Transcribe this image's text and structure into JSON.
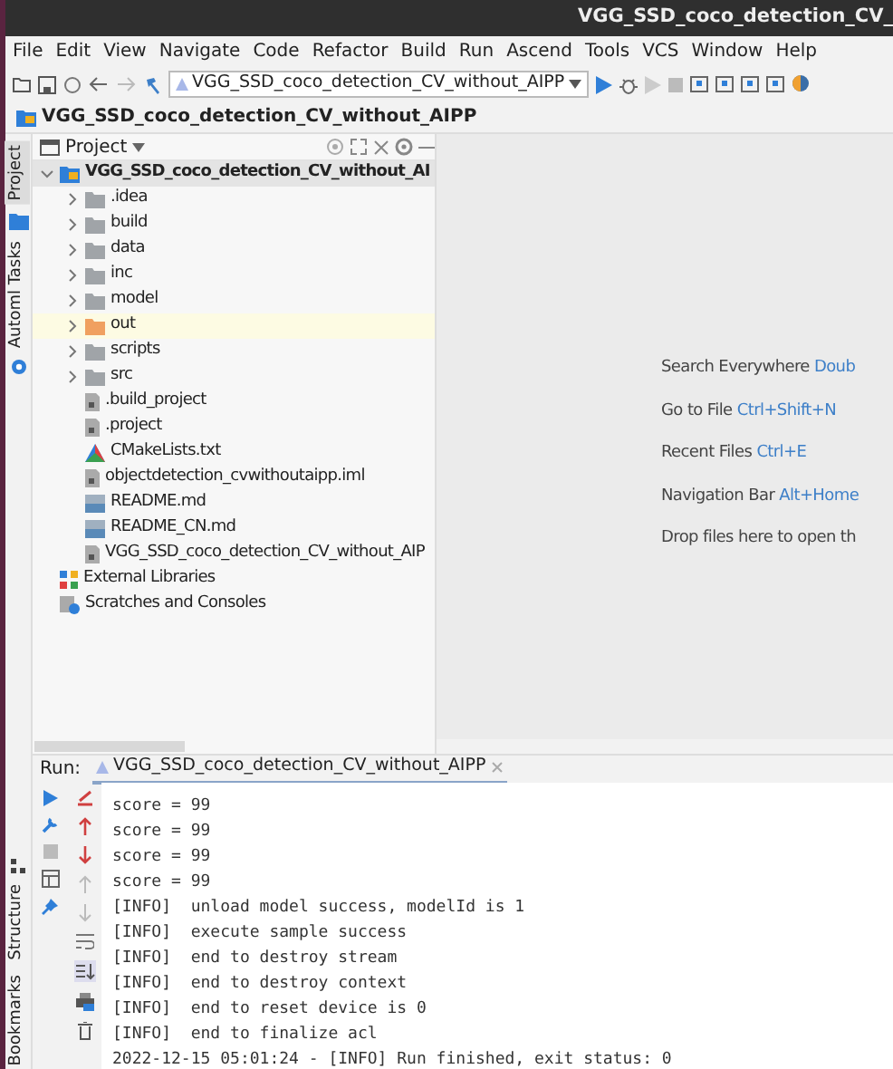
{
  "window": {
    "title": "VGG_SSD_coco_detection_CV_"
  },
  "menu": [
    "File",
    "Edit",
    "View",
    "Navigate",
    "Code",
    "Refactor",
    "Build",
    "Run",
    "Ascend",
    "Tools",
    "VCS",
    "Window",
    "Help"
  ],
  "toolbar": {
    "run_config": "VGG_SSD_coco_detection_CV_without_AIPP"
  },
  "breadcrumb": "VGG_SSD_coco_detection_CV_without_AIPP",
  "side_tabs": [
    {
      "label": "Project",
      "selected": true
    },
    {
      "label": "Automl Tasks",
      "selected": false
    }
  ],
  "bottom_side_tabs": [
    "Structure",
    "Bookmarks"
  ],
  "project_panel": {
    "title": "Project",
    "tree": [
      {
        "label": "VGG_SSD_coco_detection_CV_without_AI",
        "kind": "project",
        "expanded": true,
        "children": [
          {
            "label": ".idea",
            "kind": "folder",
            "expanded": false,
            "color": "#a0a4a8"
          },
          {
            "label": "build",
            "kind": "folder",
            "expanded": false,
            "color": "#a0a4a8"
          },
          {
            "label": "data",
            "kind": "folder",
            "expanded": false,
            "color": "#a0a4a8"
          },
          {
            "label": "inc",
            "kind": "folder",
            "expanded": false,
            "color": "#a0a4a8"
          },
          {
            "label": "model",
            "kind": "folder",
            "expanded": false,
            "color": "#a0a4a8"
          },
          {
            "label": "out",
            "kind": "folder",
            "expanded": false,
            "color": "#f0a060",
            "highlighted": true
          },
          {
            "label": "scripts",
            "kind": "folder",
            "expanded": false,
            "color": "#a0a4a8"
          },
          {
            "label": "src",
            "kind": "folder",
            "expanded": false,
            "color": "#a0a4a8"
          },
          {
            "label": ".build_project",
            "kind": "file"
          },
          {
            "label": ".project",
            "kind": "file"
          },
          {
            "label": "CMakeLists.txt",
            "kind": "cmake"
          },
          {
            "label": "objectdetection_cvwithoutaipp.iml",
            "kind": "file"
          },
          {
            "label": "README.md",
            "kind": "markdown"
          },
          {
            "label": "README_CN.md",
            "kind": "markdown"
          },
          {
            "label": "VGG_SSD_coco_detection_CV_without_AIP",
            "kind": "file"
          }
        ]
      },
      {
        "label": "External Libraries",
        "kind": "library"
      },
      {
        "label": "Scratches and Consoles",
        "kind": "scratches"
      }
    ]
  },
  "editor_hints": [
    {
      "label": "Search Everywhere",
      "shortcut": "Doub"
    },
    {
      "label": "Go to File",
      "shortcut": "Ctrl+Shift+N"
    },
    {
      "label": "Recent Files",
      "shortcut": "Ctrl+E"
    },
    {
      "label": "Navigation Bar",
      "shortcut": "Alt+Home"
    },
    {
      "label": "Drop files here to open th"
    }
  ],
  "run_panel": {
    "label": "Run:",
    "tab": "VGG_SSD_coco_detection_CV_without_AIPP",
    "lines": [
      "score = 99",
      "score = 99",
      "score = 99",
      "score = 99",
      "[INFO]  unload model success, modelId is 1",
      "[INFO]  execute sample success",
      "[INFO]  end to destroy stream",
      "[INFO]  end to destroy context",
      "[INFO]  end to reset device is 0",
      "[INFO]  end to finalize acl",
      "2022-12-15 05:01:24 - [INFO] Run finished, exit status: 0"
    ]
  }
}
